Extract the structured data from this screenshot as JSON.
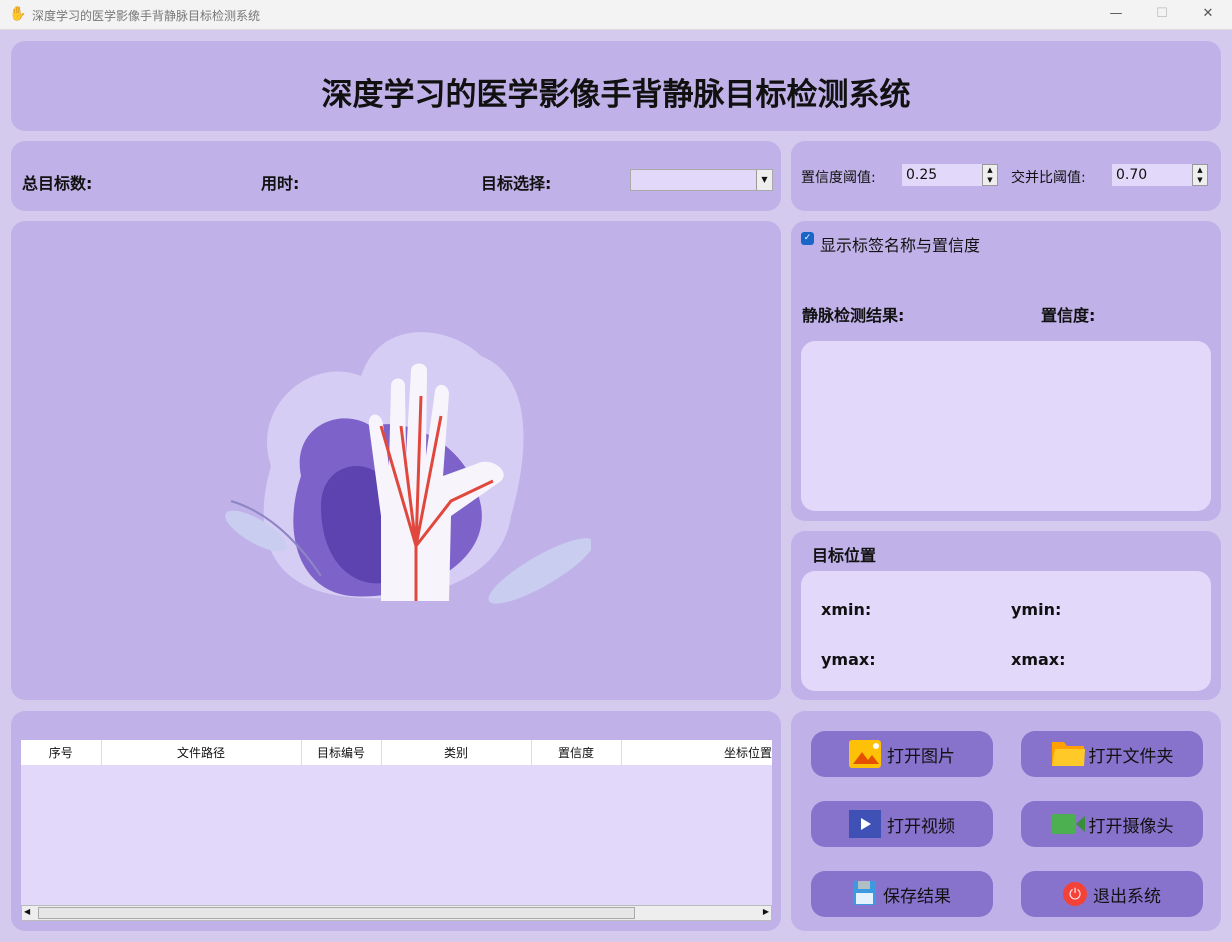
{
  "window": {
    "title": "深度学习的医学影像手背静脉目标检测系统",
    "minimize": "—",
    "maximize": "☐",
    "close": "✕"
  },
  "header": {
    "title": "深度学习的医学影像手背静脉目标检测系统"
  },
  "stats": {
    "total_label": "总目标数:",
    "time_label": "用时:",
    "select_label": "目标选择:",
    "select_value": ""
  },
  "thresholds": {
    "conf_label": "置信度阈值:",
    "conf_value": "0.25",
    "iou_label": "交并比阈值:",
    "iou_value": "0.70"
  },
  "options": {
    "show_label": "显示标签名称与置信度",
    "show_checked": true
  },
  "result": {
    "result_label": "静脉检测结果:",
    "conf_label": "置信度:"
  },
  "position": {
    "title": "目标位置",
    "xmin": "xmin:",
    "ymin": "ymin:",
    "ymax": "ymax:",
    "xmax": "xmax:"
  },
  "table": {
    "columns": [
      "序号",
      "文件路径",
      "目标编号",
      "类别",
      "置信度",
      "坐标位置"
    ],
    "rows": []
  },
  "buttons": {
    "open_image": "打开图片",
    "open_folder": "打开文件夹",
    "open_video": "打开视频",
    "open_camera": "打开摄像头",
    "save": "保存结果",
    "exit": "退出系统"
  },
  "colors": {
    "panel": "#c0b2e8",
    "inner": "#e2d8fa",
    "button": "#8772cc"
  }
}
